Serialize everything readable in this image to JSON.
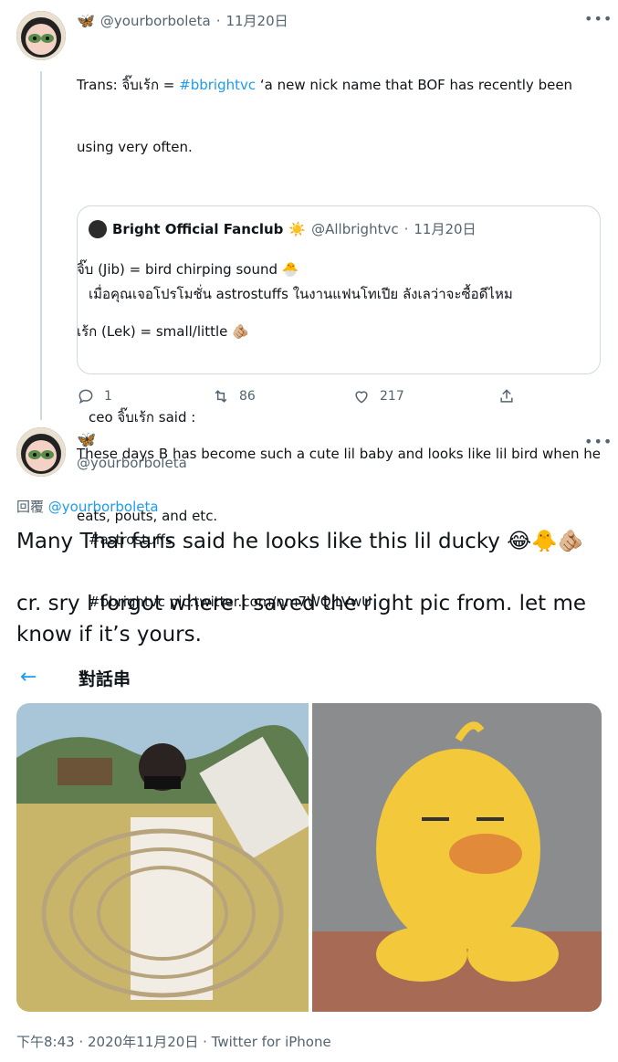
{
  "tweet1": {
    "display_name_icon": "butterfly-icon",
    "handle": "@yourborboleta",
    "dot": "·",
    "date": "11月20日",
    "line1a": "Trans: จิ๊บเร้ก = ",
    "line1_tag": "#bbrightvc",
    "line1b": " ‘a new nick name that BOF has recently been",
    "line2": "using very often.",
    "line3": "จิ๊บ (Jib) = bird chirping sound 🐣",
    "line4": "เร้ก (Lek) = small/little 🫵🏼",
    "line5": "These days B has become such a cute lil baby and looks like lil bird when he",
    "line6": "eats, pouts, and etc.",
    "quote": {
      "name": "Bright Official Fanclub",
      "badge": "☀️",
      "handle": "@Allbrightvc",
      "dot": "·",
      "date": "11月20日",
      "line1": "เมื่อคุณเจอโปรโมชั่น astrostuffs ในงานแฟนโทเปีย ลังเลว่าจะซื้อดีไหม",
      "line2": "ceo จิ๊บเร้ก said :",
      "line3": "#astrostuffs",
      "line4": "#bbrightvc pic.twitter.com/nm7WQjLVwU"
    },
    "reply_count": "1",
    "retweet_count": "86",
    "like_count": "217"
  },
  "tweet2": {
    "handle": "@yourborboleta",
    "reply_label": "回覆",
    "reply_handle": "@yourborboleta",
    "text1": "Many Thai fans said he looks like this lil ducky 😂🐥🫵🏼",
    "text2": "cr. sry I forgot where I saved the right pic from. let me",
    "text3": "know if it’s yours.",
    "footer": "下午8:43 · 2020年11月20日 · Twitter for iPhone"
  },
  "nav": {
    "back": "←",
    "title": "對話串"
  },
  "colors": {
    "accent": "#1d9bf0",
    "muted": "#536471",
    "border": "#cfd9de"
  }
}
